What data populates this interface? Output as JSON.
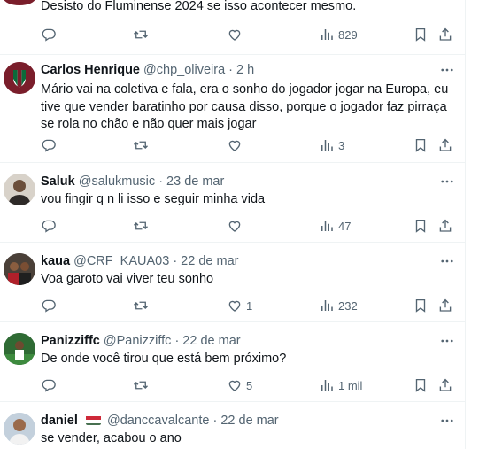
{
  "tweets": [
    {
      "text": "Desisto do Fluminense 2024 se isso acontecer mesmo.",
      "stats": {
        "views": "829"
      }
    },
    {
      "name": "Carlos Henrique",
      "handle": "@chp_oliveira",
      "time": "· 2 h",
      "text": "Mário vai na coletiva e fala, era o sonho do jogador jogar na Europa, eu tive que vender baratinho por causa disso, porque o jogador faz pirraça se rola no chão e não quer mais jogar",
      "stats": {
        "views": "3"
      }
    },
    {
      "name": "Saluk",
      "handle": "@salukmusic",
      "time": "· 23 de mar",
      "text": "vou fingir q n li isso e seguir minha vida",
      "stats": {
        "views": "47"
      }
    },
    {
      "name": "kaua",
      "handle": "@CRF_KAUA03",
      "time": "· 22 de mar",
      "text": "Voa garoto vai viver teu sonho",
      "stats": {
        "likes": "1",
        "views": "232"
      }
    },
    {
      "name": "Panizziffc",
      "handle": "@Panizziffc",
      "time": "· 22 de mar",
      "text": "De onde você tirou que está bem próximo?",
      "stats": {
        "likes": "5",
        "views": "1 mil"
      }
    },
    {
      "name": "daniel",
      "handle": "@danccavalcante",
      "time": "· 22 de mar",
      "text": "se vender, acabou o ano",
      "flag": "hungary-flag-icon"
    }
  ],
  "icons": {
    "reply": "reply-icon",
    "retweet": "retweet-icon",
    "like": "heart-icon",
    "views": "views-icon",
    "bookmark": "bookmark-icon",
    "share": "share-icon",
    "more": "more-icon"
  },
  "colors": {
    "text": "#0f1419",
    "secondary": "#536471",
    "divider": "#eff3f4"
  }
}
